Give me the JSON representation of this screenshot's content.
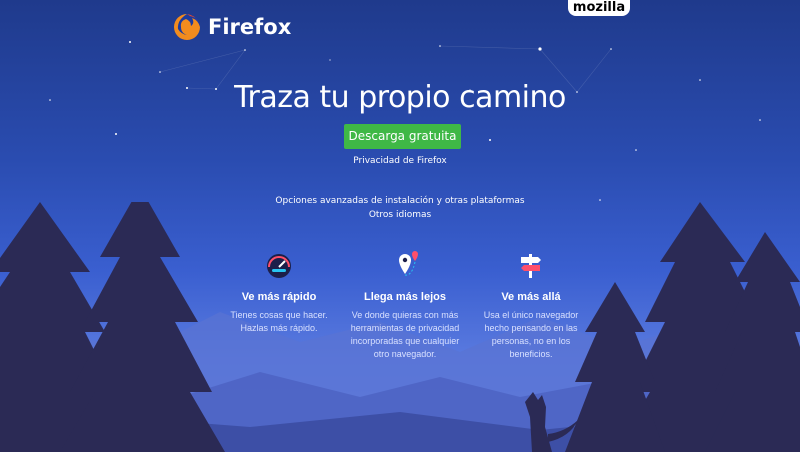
{
  "brand": {
    "mozilla_label": "mozilla",
    "logo_text": "Firefox"
  },
  "hero": {
    "headline": "Traza tu propio camino",
    "download_label": "Descarga gratuita",
    "privacy_link": "Privacidad de Firefox",
    "advanced_link": "Opciones avanzadas de instalación y otras plataformas",
    "languages_link": "Otros idiomas"
  },
  "features": [
    {
      "icon": "speedometer-icon",
      "title": "Ve más rápido",
      "desc": "Tienes cosas que hacer. Hazlas más rápido."
    },
    {
      "icon": "location-pin-icon",
      "title": "Llega más lejos",
      "desc": "Ve donde quieras con más herramientas de privacidad incorporadas que cualquier otro navegador."
    },
    {
      "icon": "signpost-icon",
      "title": "Ve más allá",
      "desc": "Usa el único navegador hecho pensando en las personas, no en los beneficios."
    }
  ],
  "colors": {
    "accent_green": "#3fb846",
    "sky_top": "#1f3a8c",
    "tree_dark": "#2b2a55"
  }
}
